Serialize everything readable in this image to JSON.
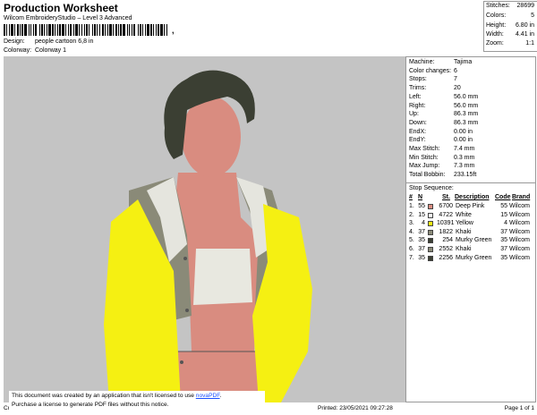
{
  "header": {
    "title": "Production Worksheet",
    "subtitle": "Wilcom EmbroideryStudio – Level 3 Advanced",
    "barcode_suffix": ",",
    "design_label": "Design:",
    "design_value": "people cartoon 6,8 in",
    "colorway_label": "Colorway:",
    "colorway_value": "Colorway 1"
  },
  "stats": [
    {
      "label": "Stitches:",
      "value": "28699"
    },
    {
      "label": "Colors:",
      "value": "5"
    },
    {
      "label": "Height:",
      "value": "6.80 in"
    },
    {
      "label": "Width:",
      "value": "4.41 in"
    },
    {
      "label": "Zoom:",
      "value": "1:1"
    }
  ],
  "machine_info": [
    {
      "label": "Machine:",
      "value": "Tajima"
    },
    {
      "label": "Color changes:",
      "value": "6"
    },
    {
      "label": "Stops:",
      "value": "7"
    },
    {
      "label": "Trims:",
      "value": "20"
    },
    {
      "label": "Left:",
      "value": "56.0 mm"
    },
    {
      "label": "Right:",
      "value": "56.0 mm"
    },
    {
      "label": "Up:",
      "value": "86.3 mm"
    },
    {
      "label": "Down:",
      "value": "86.3 mm"
    },
    {
      "label": "EndX:",
      "value": "0.00 in"
    },
    {
      "label": "EndY:",
      "value": "0.00 in"
    },
    {
      "label": "Max Stitch:",
      "value": "7.4 mm"
    },
    {
      "label": "Min Stitch:",
      "value": "0.3 mm"
    },
    {
      "label": "Max Jump:",
      "value": "7.3 mm"
    },
    {
      "label": "Total Bobbin:",
      "value": "233.15ft"
    }
  ],
  "stop_sequence": {
    "title": "Stop Sequence:",
    "columns": [
      "#",
      "N",
      "St.",
      "Description",
      "Code",
      "Brand"
    ],
    "rows": [
      {
        "num": "1.",
        "n": "55",
        "color": "#d98c80",
        "st": "6700",
        "desc": "Deep Pink",
        "code": "55",
        "brand": "Wilcom"
      },
      {
        "num": "2.",
        "n": "15",
        "color": "#ffffff",
        "st": "4722",
        "desc": "White",
        "code": "15",
        "brand": "Wilcom"
      },
      {
        "num": "3.",
        "n": "4",
        "color": "#f5f012",
        "st": "10391",
        "desc": "Yellow",
        "code": "4",
        "brand": "Wilcom"
      },
      {
        "num": "4.",
        "n": "37",
        "color": "#8a8a78",
        "st": "1822",
        "desc": "Khaki",
        "code": "37",
        "brand": "Wilcom"
      },
      {
        "num": "5.",
        "n": "35",
        "color": "#3b3f33",
        "st": "254",
        "desc": "Murky Green",
        "code": "35",
        "brand": "Wilcom"
      },
      {
        "num": "6.",
        "n": "37",
        "color": "#8a8a78",
        "st": "2552",
        "desc": "Khaki",
        "code": "37",
        "brand": "Wilcom"
      },
      {
        "num": "7.",
        "n": "35",
        "color": "#3b3f33",
        "st": "2256",
        "desc": "Murky Green",
        "code": "35",
        "brand": "Wilcom"
      }
    ]
  },
  "notice": {
    "line1_prefix": "This document was created by an application that isn't licensed to use ",
    "link": "novaPDF",
    "line1_suffix": ".",
    "line2": "Purchase a license to generate PDF files without this notice."
  },
  "footer": {
    "left": "Cr",
    "printed": "Printed: 23/05/2021 09:27:28",
    "page": "Page 1 of 1"
  }
}
